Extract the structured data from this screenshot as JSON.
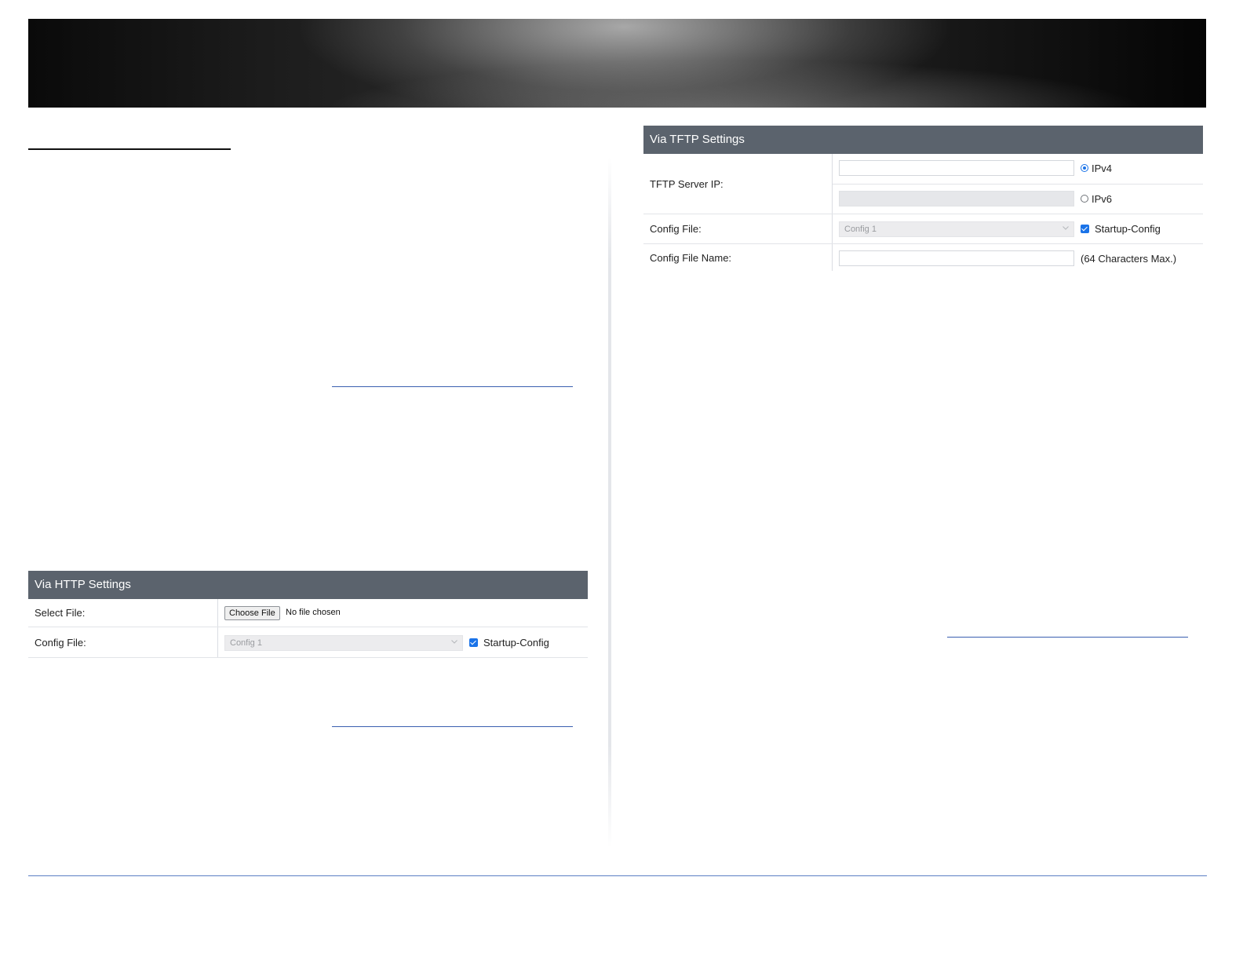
{
  "http_panel": {
    "title": "Via HTTP Settings",
    "select_file_label": "Select File:",
    "choose_file_button": "Choose File",
    "file_status": "No file chosen",
    "config_file_label": "Config File:",
    "config_file_value": "Config 1",
    "startup_config_label": "Startup-Config",
    "startup_config_checked": true
  },
  "tftp_panel": {
    "title": "Via TFTP Settings",
    "server_ip_label": "TFTP Server IP:",
    "ipv4_label": "IPv4",
    "ipv6_label": "IPv6",
    "ip_version_selected": "IPv4",
    "ipv4_value": "",
    "ipv6_value": "",
    "config_file_label": "Config File:",
    "config_file_value": "Config 1",
    "startup_config_label": "Startup-Config",
    "startup_config_checked": true,
    "config_file_name_label": "Config File Name:",
    "config_file_name_value": "",
    "config_file_name_hint": "(64 Characters Max.)"
  },
  "colors": {
    "panel_header": "#5b636d",
    "accent": "#1a73e8",
    "footer_line": "#5b7fc4"
  },
  "icons": {
    "dropdown": "chevron-down-icon"
  }
}
